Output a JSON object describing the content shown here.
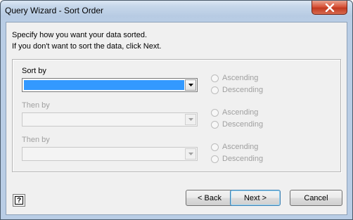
{
  "window": {
    "title": "Query Wizard - Sort Order"
  },
  "instructions": {
    "line1": "Specify how you want your data sorted.",
    "line2": "If you don't want to sort the data, click Next."
  },
  "sort_levels": [
    {
      "label": "Sort by",
      "enabled": true,
      "value": "",
      "ascending": "Ascending",
      "descending": "Descending"
    },
    {
      "label": "Then by",
      "enabled": false,
      "value": "",
      "ascending": "Ascending",
      "descending": "Descending"
    },
    {
      "label": "Then by",
      "enabled": false,
      "value": "",
      "ascending": "Ascending",
      "descending": "Descending"
    }
  ],
  "buttons": {
    "back": "< Back",
    "next": "Next >",
    "cancel": "Cancel",
    "help": "?"
  },
  "colors": {
    "selection": "#3399ff",
    "disabled_text": "#a0a0a0",
    "close_button": "#c23a20"
  },
  "icons": {
    "close": "close-icon",
    "dropdown": "chevron-down-icon",
    "help": "help-icon"
  }
}
